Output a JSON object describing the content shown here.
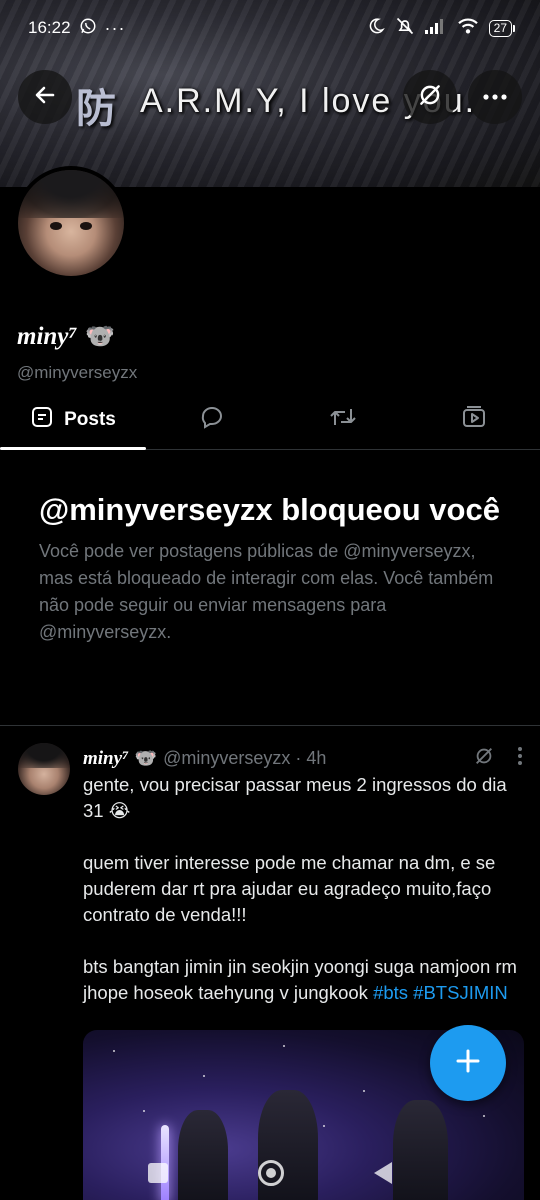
{
  "status_bar": {
    "time": "16:22",
    "battery": "27",
    "icons": [
      "whatsapp-icon",
      "more-notifications-icon",
      "moon-icon",
      "mute-icon",
      "signal-icon",
      "wifi-icon",
      "battery-icon"
    ]
  },
  "banner": {
    "caption": "A.R.M.Y, I love you.",
    "glyph": "防"
  },
  "header": {
    "back_icon": "arrow-left-icon",
    "grok_icon": "slash-circle-icon",
    "more_icon": "ellipsis-icon"
  },
  "profile": {
    "display_name": "miny⁷",
    "name_emoji": "🐨",
    "handle": "@minyverseyzx",
    "avatar_label_line1": "",
    "avatar_label_line2": ""
  },
  "tabs": [
    {
      "label": "Posts",
      "icon": "posts-icon",
      "active": true
    },
    {
      "label": "",
      "icon": "reply-icon",
      "active": false
    },
    {
      "label": "",
      "icon": "repost-icon",
      "active": false
    },
    {
      "label": "",
      "icon": "media-icon",
      "active": false
    }
  ],
  "blocked": {
    "title": "@minyverseyzx bloqueou você",
    "description": "Você pode ver postagens públicas de @minyverseyzx, mas está bloqueado de interagir com elas. Você também não pode seguir ou enviar mensagens para @minyverseyzx."
  },
  "tweet": {
    "display_name": "miny⁷",
    "emoji": "🐨",
    "meta": "@minyverseyzx · 4h",
    "paragraph1": "gente, vou precisar passar meus 2 ingressos do dia 31 😭",
    "paragraph2": "quem tiver interesse pode me chamar na dm, e se puderem dar rt pra ajudar eu agradeço muito,faço contrato de venda!!!",
    "paragraph3_text": "bts bangtan jimin jin seokjin yoongi suga namjoon rm jhope hoseok taehyung v jungkook ",
    "hashtag1": "#bts",
    "hashtag2": "#BTSJIMIN"
  },
  "colors": {
    "accent": "#1d9bf0",
    "muted": "#71767b",
    "divider": "#2f3336",
    "background": "#000000"
  }
}
